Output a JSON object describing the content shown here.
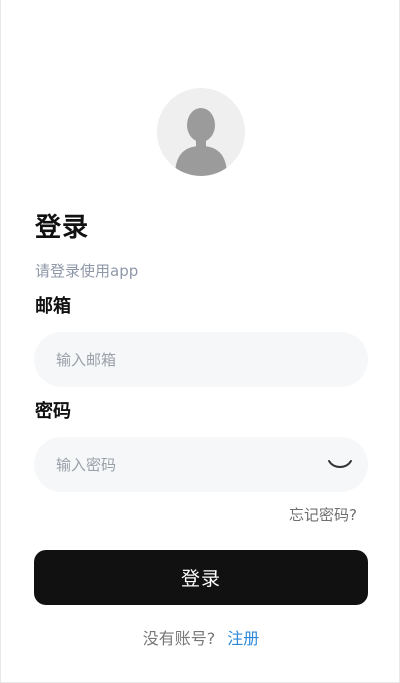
{
  "avatar": {
    "icon": "user-silhouette-icon"
  },
  "header": {
    "title": "登录",
    "subtitle": "请登录使用app"
  },
  "form": {
    "email": {
      "label": "邮箱",
      "value": "",
      "placeholder": "输入邮箱"
    },
    "password": {
      "label": "密码",
      "value": "",
      "placeholder": "输入密码",
      "toggle_icon": "eye-closed-icon"
    },
    "forgot_label": "忘记密码?",
    "submit_label": "登录"
  },
  "footer": {
    "prompt": "没有账号?",
    "register_label": "注册"
  },
  "colors": {
    "background": "#ffffff",
    "field_background": "#f6f7f9",
    "button_background": "#111111",
    "link": "#2d8ad8",
    "subtitle": "#8f98a8"
  }
}
